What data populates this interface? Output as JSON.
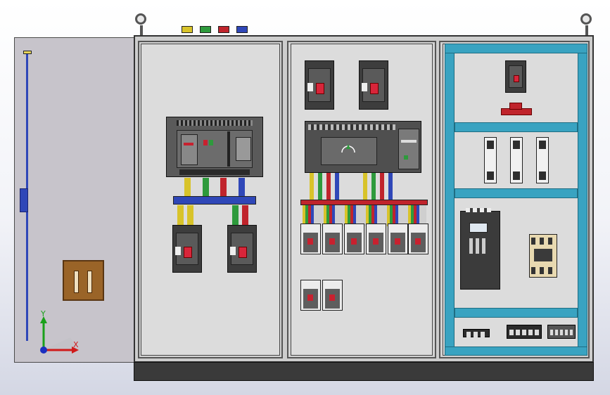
{
  "window": {
    "width": 867,
    "height": 562
  },
  "axis": {
    "x_label": "X",
    "y_label": "Y"
  },
  "colors": {
    "background_top": "#ffffff",
    "background_bottom": "#d4d7e4",
    "door": "#c7c4cb",
    "rod": "#2f47b8",
    "cabinet": "#cdcdcd",
    "plinth": "#3a3a3a",
    "din_channel": "#39a3c1",
    "phase_colors": [
      "#d8c32a",
      "#2e9a3c",
      "#c0242c",
      "#2f47b8"
    ]
  },
  "icons": {
    "lifting_eye": "lifting-eye-icon",
    "breaker": "breaker-icon",
    "plc": "plc-icon",
    "inverter": "inverter-icon",
    "contactor": "contactor-icon",
    "fuse": "fuse-holder-icon",
    "terminal_block": "terminal-block-icon"
  }
}
